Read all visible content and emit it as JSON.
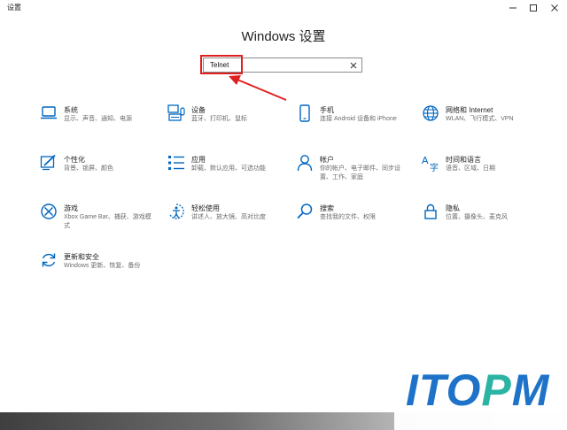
{
  "window": {
    "title": "设置"
  },
  "header": {
    "title": "Windows 设置"
  },
  "search": {
    "value": "Telnet"
  },
  "colors": {
    "accent": "#0067c0",
    "annotation": "#e02020",
    "watermark_blue": "#1e73c9",
    "watermark_green": "#2bb3a4"
  },
  "tiles": [
    {
      "name": "系统",
      "desc": "显示、声音、通知、电源",
      "icon": "laptop-icon"
    },
    {
      "name": "设备",
      "desc": "蓝牙、打印机、鼠标",
      "icon": "keyboard-icon"
    },
    {
      "name": "手机",
      "desc": "连接 Android 设备和 iPhone",
      "icon": "phone-icon"
    },
    {
      "name": "网络和 Internet",
      "desc": "WLAN、飞行模式、VPN",
      "icon": "globe-icon"
    },
    {
      "name": "个性化",
      "desc": "背景、锁屏、颜色",
      "icon": "paint-icon"
    },
    {
      "name": "应用",
      "desc": "卸载、默认应用、可选功能",
      "icon": "apps-list-icon"
    },
    {
      "name": "帐户",
      "desc": "你的帐户、电子邮件、同步设置、工作、家庭",
      "icon": "person-icon"
    },
    {
      "name": "时间和语言",
      "desc": "语音、区域、日期",
      "icon": "language-icon"
    },
    {
      "name": "游戏",
      "desc": "Xbox Game Bar、捕获、游戏模式",
      "icon": "xbox-icon"
    },
    {
      "name": "轻松使用",
      "desc": "讲述人、放大镜、高对比度",
      "icon": "accessibility-icon"
    },
    {
      "name": "搜索",
      "desc": "查找我的文件、权限",
      "icon": "search-icon"
    },
    {
      "name": "隐私",
      "desc": "位置、摄像头、麦克风",
      "icon": "lock-icon"
    },
    {
      "name": "更新和安全",
      "desc": "Windows 更新、恢复、备份",
      "icon": "sync-icon"
    }
  ],
  "watermark": {
    "part1": "ITO",
    "part2": "P",
    "part3": "M"
  }
}
